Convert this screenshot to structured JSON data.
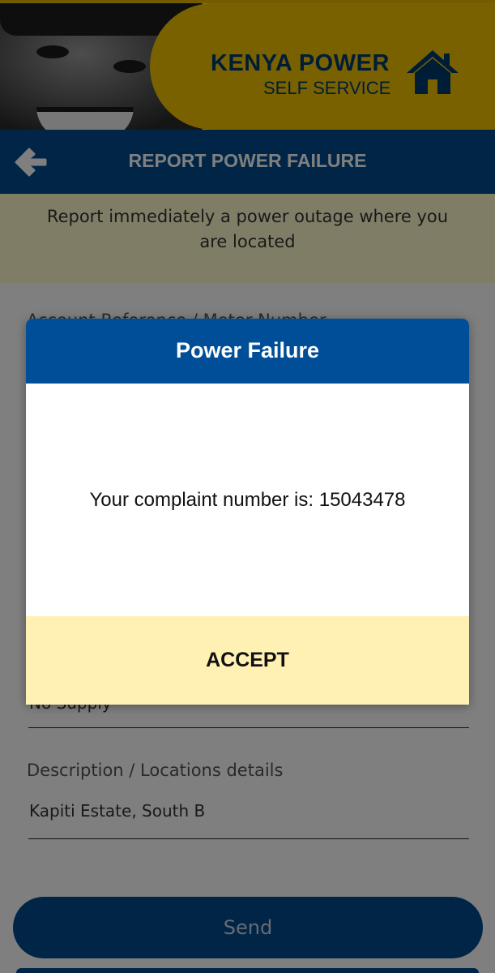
{
  "brand": {
    "title": "KENYA POWER",
    "subtitle": "SELF SERVICE",
    "icon": "home-icon",
    "color_primary": "#003a70",
    "color_accent": "#f5c300"
  },
  "titlebar": {
    "back_icon": "arrow-left-icon",
    "title": "REPORT POWER FAILURE"
  },
  "intro": {
    "text": "Report immediately a power outage where you are located"
  },
  "form": {
    "account_label": "Account Reference / Meter Number",
    "failure_type_value": "No Supply",
    "description_label": "Description / Locations details",
    "description_value": "Kapiti Estate, South B",
    "send_label": "Send"
  },
  "dialog": {
    "title": "Power Failure",
    "message": "Your complaint number is: 15043478",
    "accept_label": "ACCEPT"
  }
}
